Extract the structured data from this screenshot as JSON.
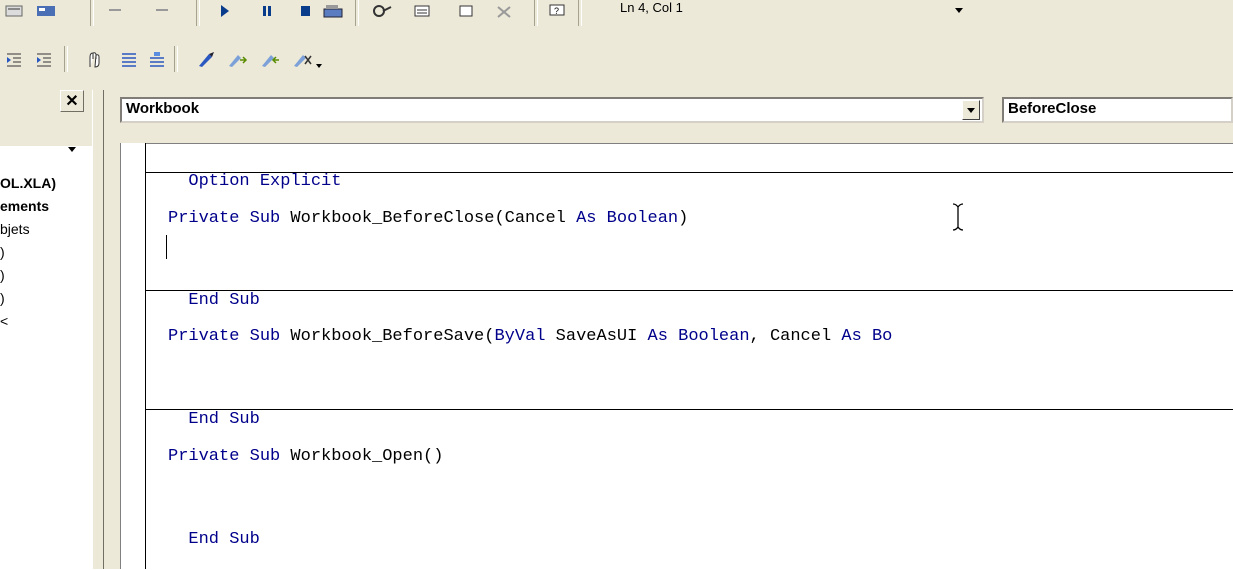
{
  "toolbar": {
    "cursor_position": "Ln 4, Col 1",
    "row1_icons": [
      "view-excel-icon",
      "insert-module-icon",
      "undo-icon",
      "redo-icon",
      "run-icon",
      "break-icon",
      "reset-icon",
      "design-mode-icon",
      "project-explorer-icon",
      "properties-icon",
      "object-browser-icon",
      "toolbox-icon",
      "help-icon"
    ],
    "row2_icons": [
      "outdent-icon",
      "indent-icon",
      "toggle-breakpoint-icon",
      "comment-block-icon",
      "uncomment-block-icon",
      "toggle-bookmark-icon",
      "next-bookmark-icon",
      "previous-bookmark-icon",
      "clear-bookmarks-icon"
    ]
  },
  "explorer": {
    "close_label": "✕",
    "items": [
      {
        "label": "OL.XLA)",
        "bold": true
      },
      {
        "label": "ements",
        "bold": true
      },
      {
        "label": "bjets",
        "bold": false
      },
      {
        "label": ")",
        "bold": false
      },
      {
        "label": ")",
        "bold": false
      },
      {
        "label": ")",
        "bold": false
      },
      {
        "label": "<",
        "bold": false
      }
    ]
  },
  "code_window": {
    "object_combo": "Workbook",
    "procedure_combo": "BeforeClose",
    "lines": {
      "l1": "Option Explicit",
      "l2_kw1": "Private Sub",
      "l2_name": " Workbook_BeforeClose(Cancel ",
      "l2_kw2": "As Boolean",
      "l2_tail": ")",
      "l3_kw": "End Sub",
      "l4_kw1": "Private Sub",
      "l4_name": " Workbook_BeforeSave(",
      "l4_kw2": "ByVal",
      "l4_mid": " SaveAsUI ",
      "l4_kw3": "As Boolean",
      "l4_mid2": ", Cancel ",
      "l4_kw4": "As Bo",
      "l5_kw": "End Sub",
      "l6_kw1": "Private Sub",
      "l6_name": " Workbook_Open()",
      "l7_kw": "End Sub"
    }
  },
  "colors": {
    "keyword": "#00008b",
    "chrome": "#ece9d8"
  }
}
